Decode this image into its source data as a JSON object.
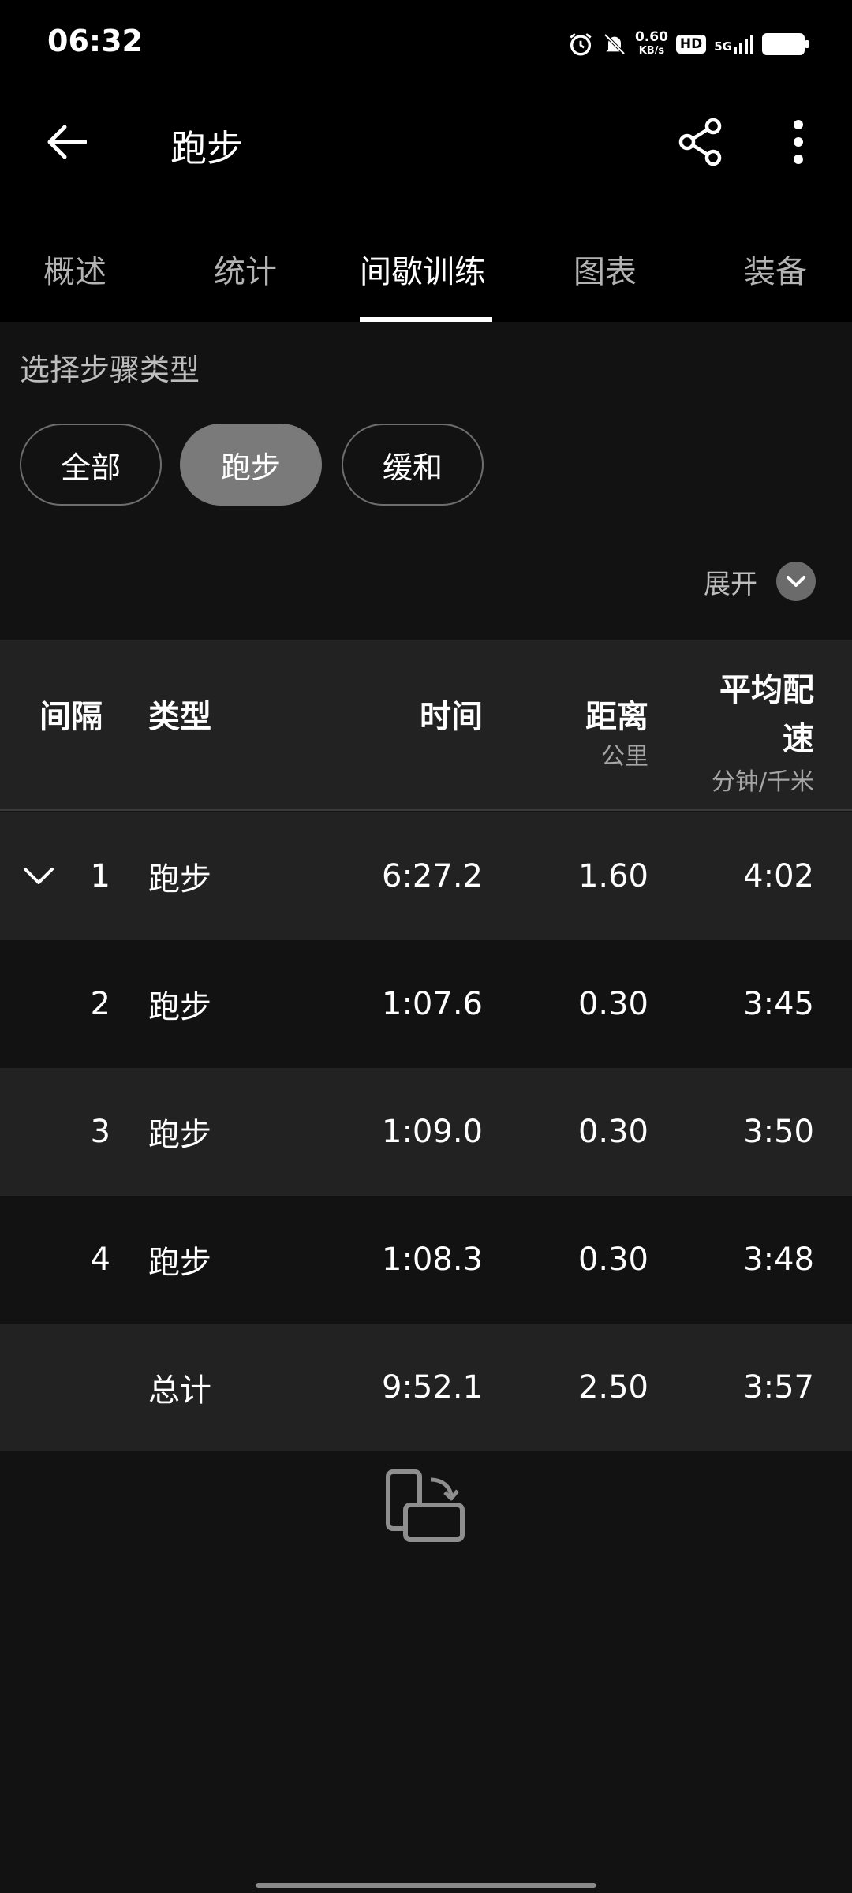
{
  "status": {
    "time": "06:32",
    "net_speed_value": "0.60",
    "net_speed_unit": "KB/s",
    "hd_badge": "HD",
    "network": "5G"
  },
  "header": {
    "title": "跑步"
  },
  "tabs": [
    {
      "label": "概述",
      "active": false
    },
    {
      "label": "统计",
      "active": false
    },
    {
      "label": "间歇训练",
      "active": true
    },
    {
      "label": "图表",
      "active": false
    },
    {
      "label": "装备",
      "active": false
    }
  ],
  "filter": {
    "label": "选择步骤类型",
    "chips": [
      {
        "label": "全部",
        "selected": false
      },
      {
        "label": "跑步",
        "selected": true
      },
      {
        "label": "缓和",
        "selected": false
      }
    ]
  },
  "expand_label": "展开",
  "table": {
    "headers": {
      "interval": "间隔",
      "type": "类型",
      "time": "时间",
      "distance": "距离",
      "distance_unit": "公里",
      "pace_line1": "平均配",
      "pace_line2": "速",
      "pace_unit": "分钟/千米"
    },
    "rows": [
      {
        "interval": "1",
        "type": "跑步",
        "time": "6:27.2",
        "distance": "1.60",
        "pace": "4:02"
      },
      {
        "interval": "2",
        "type": "跑步",
        "time": "1:07.6",
        "distance": "0.30",
        "pace": "3:45"
      },
      {
        "interval": "3",
        "type": "跑步",
        "time": "1:09.0",
        "distance": "0.30",
        "pace": "3:50"
      },
      {
        "interval": "4",
        "type": "跑步",
        "time": "1:08.3",
        "distance": "0.30",
        "pace": "3:48"
      }
    ],
    "total": {
      "label": "总计",
      "time": "9:52.1",
      "distance": "2.50",
      "pace": "3:57"
    }
  },
  "colors": {
    "background": "#121212",
    "bar": "#000000",
    "row_shade": "#222222",
    "chip_selected": "#7a7a7a"
  }
}
